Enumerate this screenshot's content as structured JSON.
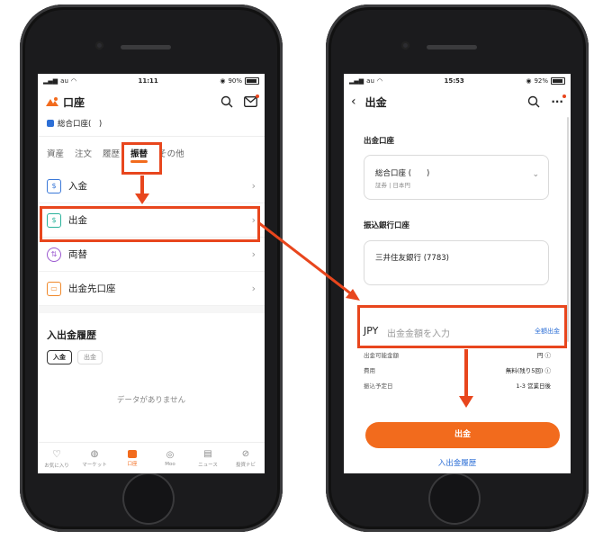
{
  "left": {
    "status": {
      "carrier": "au",
      "time": "11:11",
      "battery": "90%"
    },
    "header": {
      "title": "口座",
      "logo_icon": "moomoo-logo-icon"
    },
    "account": {
      "label": "総合口座(　)"
    },
    "tabs": [
      {
        "label": "資産"
      },
      {
        "label": "注文"
      },
      {
        "label": "履歴"
      },
      {
        "label": "振替",
        "active": true
      },
      {
        "label": "その他"
      }
    ],
    "menu": [
      {
        "label": "入金",
        "icon": "deposit-icon",
        "color": "#3a78d8"
      },
      {
        "label": "出金",
        "icon": "withdraw-icon",
        "color": "#2bb39b"
      },
      {
        "label": "両替",
        "icon": "exchange-icon",
        "color": "#9b59d0"
      },
      {
        "label": "出金先口座",
        "icon": "bank-card-icon",
        "color": "#f0892b"
      }
    ],
    "history": {
      "title": "入出金履歴",
      "chips": [
        "入金",
        "出金"
      ],
      "empty": "データがありません"
    },
    "nav": [
      {
        "label": "お気に入り",
        "icon": "heart-icon"
      },
      {
        "label": "マーケット",
        "icon": "planet-icon"
      },
      {
        "label": "口座",
        "icon": "wallet-icon",
        "active": true
      },
      {
        "label": "Moo",
        "icon": "moo-icon"
      },
      {
        "label": "ニュース",
        "icon": "news-icon"
      },
      {
        "label": "投資ナビ",
        "icon": "compass-icon"
      }
    ]
  },
  "right": {
    "status": {
      "carrier": "au",
      "time": "15:53",
      "battery": "92%"
    },
    "header": {
      "title": "出金"
    },
    "withdraw_account": {
      "label": "出金口座",
      "value": "総合口座 (　　)",
      "sub": "証券 | 日本円"
    },
    "bank_account": {
      "label": "振込銀行口座",
      "value": "三井住友銀行 (7783)"
    },
    "amount": {
      "currency": "JPY",
      "placeholder": "出金金額を入力",
      "all_label": "全額出金"
    },
    "details": [
      {
        "key": "出金可能金額",
        "value": "円"
      },
      {
        "key": "費用",
        "value": "無料(残り5回)"
      },
      {
        "key": "振込予定日",
        "value": "1-3 営業日後"
      }
    ],
    "submit": "出金",
    "history_link": "入出金履歴"
  },
  "colors": {
    "accent": "#f26b1d",
    "highlight": "#e8461d",
    "link": "#2d6fd6"
  }
}
